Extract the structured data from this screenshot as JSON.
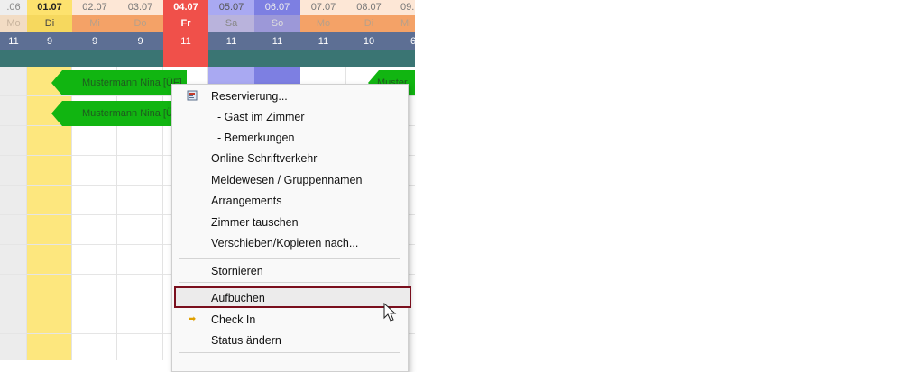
{
  "calendar": {
    "columns": [
      {
        "date": ".06",
        "weekday": "Mo",
        "count": "11"
      },
      {
        "date": "01.07",
        "weekday": "Di",
        "count": "9"
      },
      {
        "date": "02.07",
        "weekday": "Mi",
        "count": "9"
      },
      {
        "date": "03.07",
        "weekday": "Do",
        "count": "9"
      },
      {
        "date": "04.07",
        "weekday": "Fr",
        "count": "11"
      },
      {
        "date": "05.07",
        "weekday": "Sa",
        "count": "11"
      },
      {
        "date": "06.07",
        "weekday": "So",
        "count": "11"
      },
      {
        "date": "07.07",
        "weekday": "Mo",
        "count": "11"
      },
      {
        "date": "08.07",
        "weekday": "Di",
        "count": "10"
      },
      {
        "date": "09.",
        "weekday": "Mi",
        "count": "6"
      }
    ],
    "bookings": [
      {
        "label": "Mustermann Nina [ÜF]"
      },
      {
        "label": "Mustermann Nina [ÜF]"
      },
      {
        "label": "Muster"
      }
    ],
    "colors": {
      "today": "#fde26e",
      "friday": "#f0504a",
      "saturday": "#a9a9f2",
      "sunday": "#7d7fe2",
      "booking": "#11b511"
    }
  },
  "context_menu": {
    "items": [
      {
        "label": "Reservierung...",
        "icon": "reservation-icon"
      },
      {
        "label": "- Gast im Zimmer"
      },
      {
        "label": "- Bemerkungen"
      },
      {
        "label": "Online-Schriftverkehr"
      },
      {
        "label": "Meldewesen / Gruppennamen"
      },
      {
        "label": "Arrangements"
      },
      {
        "label": "Zimmer tauschen"
      },
      {
        "label": "Verschieben/Kopieren nach..."
      },
      {
        "label": "Stornieren"
      },
      {
        "label": "Aufbuchen"
      },
      {
        "label": "Check In",
        "icon": "arrow-right-icon"
      },
      {
        "label": "Status ändern"
      }
    ],
    "highlighted": "Aufbuchen"
  }
}
